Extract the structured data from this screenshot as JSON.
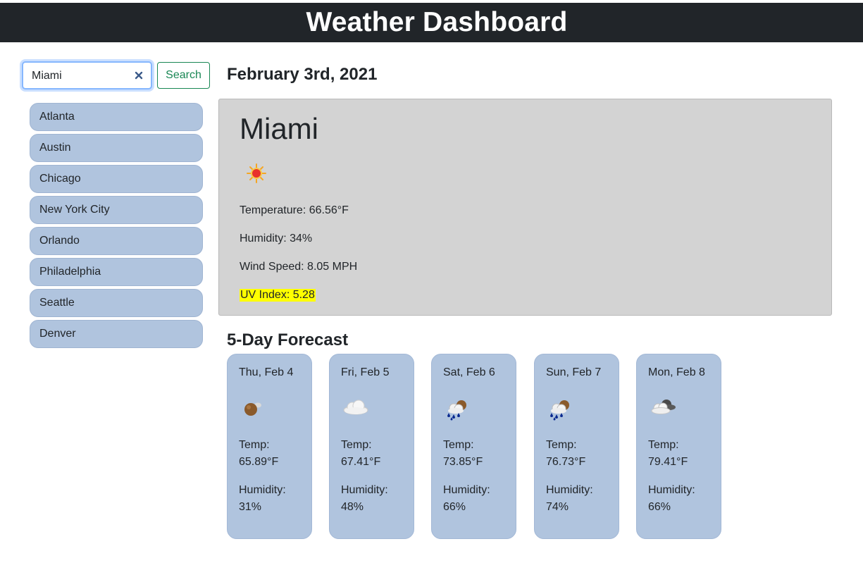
{
  "header": {
    "title": "Weather Dashboard"
  },
  "search": {
    "value": "Miami",
    "button_label": "Search"
  },
  "history": [
    {
      "label": "Atlanta"
    },
    {
      "label": "Austin"
    },
    {
      "label": "Chicago"
    },
    {
      "label": "New York City"
    },
    {
      "label": "Orlando"
    },
    {
      "label": "Philadelphia"
    },
    {
      "label": "Seattle"
    },
    {
      "label": "Denver"
    }
  ],
  "current": {
    "date": "February 3rd, 2021",
    "city": "Miami",
    "icon": "sun-icon",
    "temperature": "Temperature: 66.56°F",
    "humidity": "Humidity: 34%",
    "wind": "Wind Speed: 8.05 MPH",
    "uv": "UV Index: 5.28",
    "uv_highlight_color": "#ffff00"
  },
  "forecast": {
    "heading": "5-Day Forecast",
    "temp_label": "Temp:",
    "humidity_label": "Humidity:",
    "days": [
      {
        "date": "Thu, Feb 4",
        "icon": "moon-few-clouds-icon",
        "temp": "65.89°F",
        "humidity": "31%"
      },
      {
        "date": "Fri, Feb 5",
        "icon": "cloud-icon",
        "temp": "67.41°F",
        "humidity": "48%"
      },
      {
        "date": "Sat, Feb 6",
        "icon": "rain-icon",
        "temp": "73.85°F",
        "humidity": "66%"
      },
      {
        "date": "Sun, Feb 7",
        "icon": "rain-icon",
        "temp": "76.73°F",
        "humidity": "74%"
      },
      {
        "date": "Mon, Feb 8",
        "icon": "broken-clouds-icon",
        "temp": "79.41°F",
        "humidity": "66%"
      }
    ]
  },
  "colors": {
    "header_bg": "#212529",
    "card_bg": "#d3d3d3",
    "list_bg": "#b0c4de",
    "search_accent": "#198754"
  }
}
